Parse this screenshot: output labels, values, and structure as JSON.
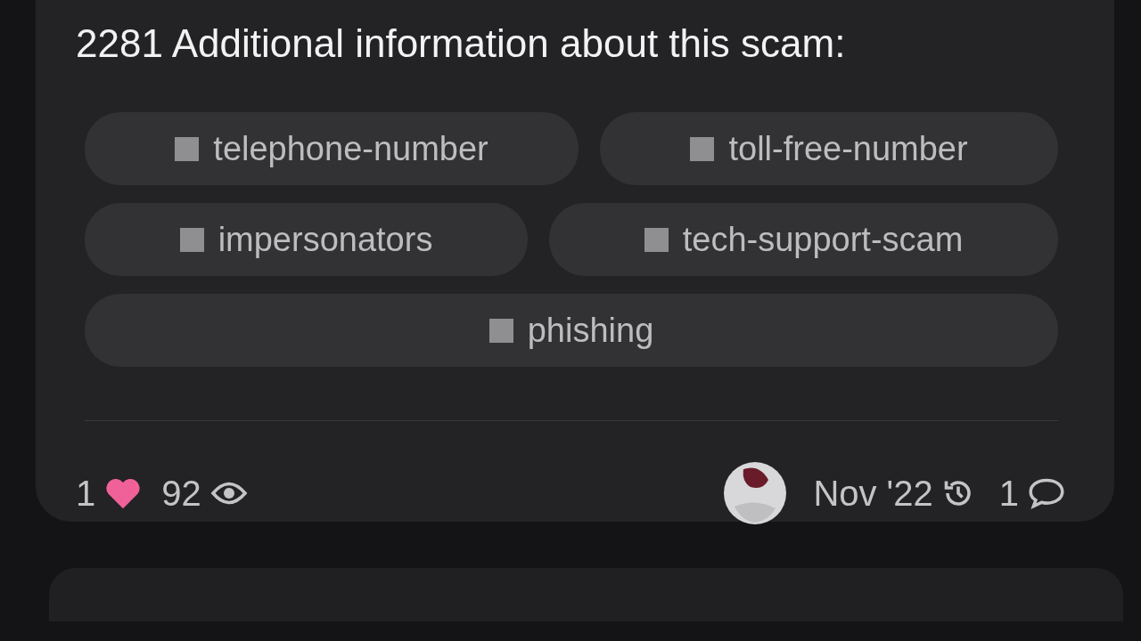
{
  "post": {
    "text": "2281 Additional information about this scam:",
    "tags": [
      {
        "label": "telephone-number"
      },
      {
        "label": "toll-free-number"
      },
      {
        "label": "impersonators"
      },
      {
        "label": "tech-support-scam"
      },
      {
        "label": "phishing"
      }
    ],
    "footer": {
      "likes": "1",
      "views": "92",
      "activity": "Nov '22",
      "replies": "1"
    }
  }
}
